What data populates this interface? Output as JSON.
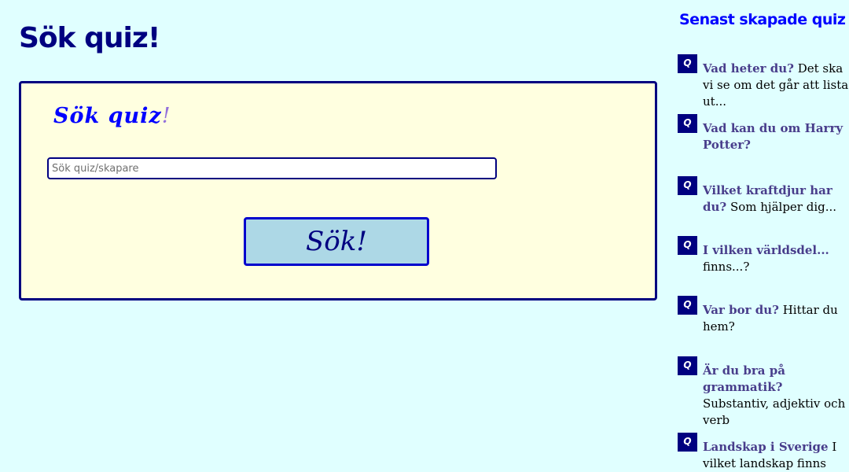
{
  "page": {
    "title": "Sök quiz!"
  },
  "search": {
    "card_title": "Sök quiz",
    "card_title_accent": "!",
    "placeholder": "Sök quiz/skapare",
    "value": "",
    "button_label": "Sök!"
  },
  "sidebar": {
    "title": "Senast skapade quiz",
    "icon_label": "Q",
    "quizzes": [
      {
        "title": "Vad heter du?",
        "description": "Det ska vi se om det går att lista ut..."
      },
      {
        "title": "Vad kan du om Harry Potter?",
        "description": ""
      },
      {
        "title": "Vilket kraftdjur har du?",
        "description": "Som hjälper dig..."
      },
      {
        "title": "I vilken världsdel...",
        "description": "finns...?"
      },
      {
        "title": "Var bor du?",
        "description": "Hittar du hem?"
      },
      {
        "title": "Är du bra på grammatik?",
        "description": "Substantiv, adjektiv och verb"
      },
      {
        "title": "Landskap i Sverige",
        "description": "I vilket landskap finns staden?"
      }
    ]
  },
  "colors": {
    "background": "#e0ffff",
    "card_background": "#ffffe0",
    "navy": "#000080",
    "accent_blue": "#0000ff",
    "button_background": "#add8e6",
    "link_color": "#483d8b"
  }
}
